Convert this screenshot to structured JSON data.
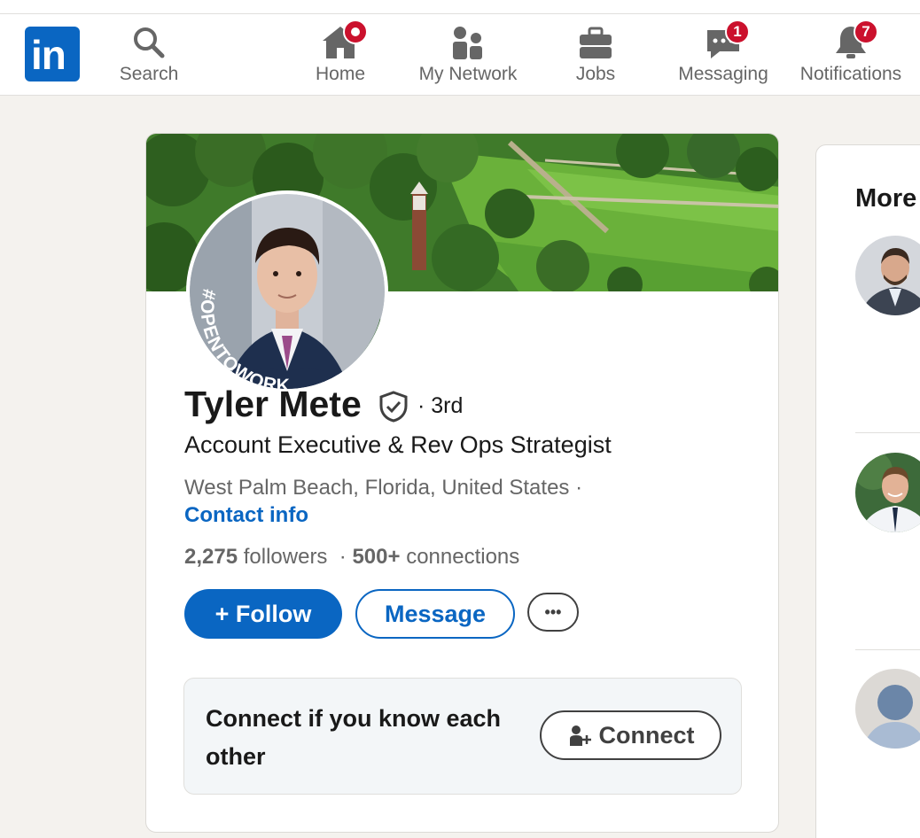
{
  "nav": {
    "logo": "in",
    "items": [
      {
        "label": "Search",
        "icon": "search-icon"
      },
      {
        "label": "Home",
        "icon": "home-icon",
        "badge": ""
      },
      {
        "label": "My Network",
        "icon": "network-icon"
      },
      {
        "label": "Jobs",
        "icon": "briefcase-icon"
      },
      {
        "label": "Messaging",
        "icon": "messaging-icon",
        "badge": "1"
      },
      {
        "label": "Notifications",
        "icon": "bell-icon",
        "badge": "7"
      }
    ]
  },
  "profile": {
    "name": "Tyler Mete",
    "verified_icon": "verified-shield-icon",
    "degree": "· 3rd",
    "frame_text": "#OPENTOWORK",
    "headline": "Account Executive & Rev Ops Strategist",
    "location": "West Palm Beach, Florida, United States ·",
    "contact_info": "Contact info",
    "followers_count": "2,275",
    "followers_label": "followers",
    "connections_sep": "·",
    "connections_count": "500+",
    "connections_label": "connections",
    "actions": {
      "follow": "+ Follow",
      "message": "Message",
      "more": "•••"
    },
    "connect_prompt": {
      "text": "Connect if you know each other",
      "button": "Connect"
    }
  },
  "side": {
    "title": "More"
  },
  "colors": {
    "brand": "#0a66c2",
    "badge": "#cb112d",
    "open_to_work": "#3b6e35"
  }
}
